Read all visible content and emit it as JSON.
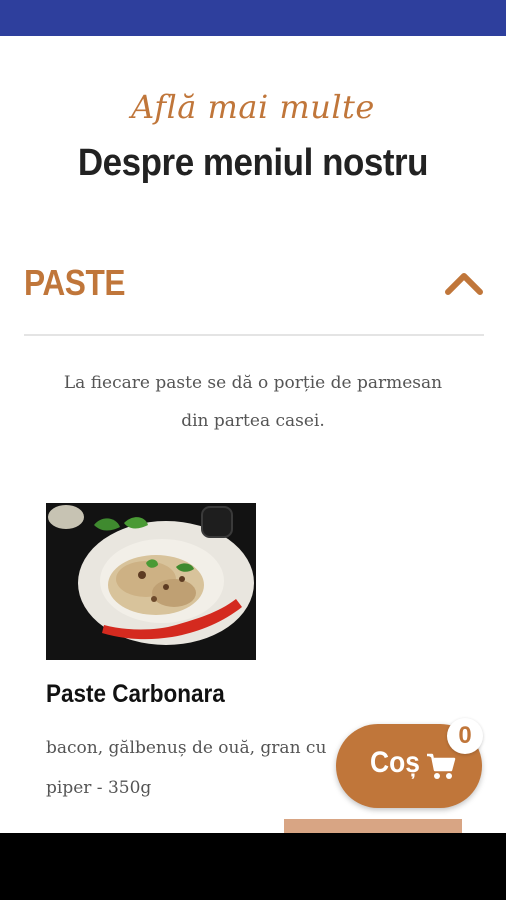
{
  "header": {
    "subtitle": "Află mai multe",
    "title": "Despre meniul nostru"
  },
  "section": {
    "title": "PASTE",
    "expanded": true,
    "icon": "chevron-up-icon",
    "note": "La fiecare paste se dă o porție de parmesan din partea casei."
  },
  "dishes": [
    {
      "name": "Paste Carbonara",
      "description": "bacon, gălbenuș de ouă, gran cu... piper - 350g",
      "description_visible_line1": "bacon, gălbenuș de ouă, gran cu",
      "description_visible_line2": "piper - 350g",
      "image": "pasta-dish-photo"
    }
  ],
  "cart": {
    "label": "Coș",
    "icon": "shopping-cart-icon",
    "count": "0"
  },
  "colors": {
    "status_bar": "#2e3f9d",
    "accent": "#c0763a",
    "text_dark": "#222222",
    "text_body": "#555555"
  }
}
